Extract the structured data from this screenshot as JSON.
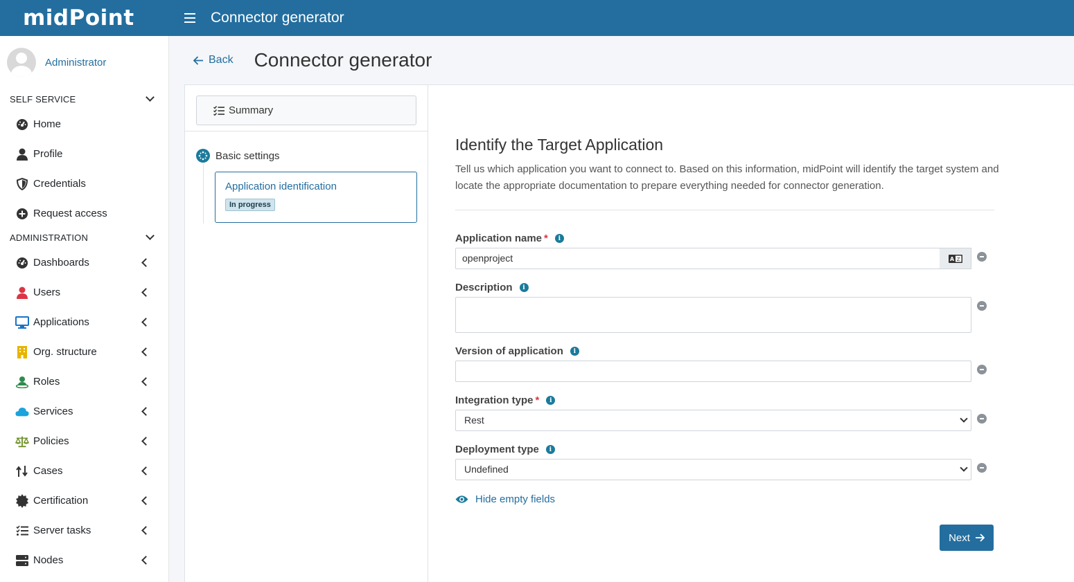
{
  "app": {
    "logo": "midPoint",
    "page_title": "Connector generator"
  },
  "user": {
    "name": "Administrator"
  },
  "sidebar": {
    "sections": [
      {
        "label": "SELF SERVICE"
      },
      {
        "label": "ADMINISTRATION"
      }
    ],
    "self_service": [
      {
        "label": "Home",
        "icon": "dashboard-gauge-icon"
      },
      {
        "label": "Profile",
        "icon": "user-icon"
      },
      {
        "label": "Credentials",
        "icon": "shield-icon"
      },
      {
        "label": "Request access",
        "icon": "plus-circle-icon"
      }
    ],
    "administration": [
      {
        "label": "Dashboards",
        "icon": "dashboard-gauge-icon"
      },
      {
        "label": "Users",
        "icon": "user-icon",
        "color": "#dc3545"
      },
      {
        "label": "Applications",
        "icon": "monitor-icon",
        "color": "#1a73c8"
      },
      {
        "label": "Org. structure",
        "icon": "building-icon",
        "color": "#e8b400"
      },
      {
        "label": "Roles",
        "icon": "role-icon",
        "color": "#2f8a4d"
      },
      {
        "label": "Services",
        "icon": "cloud-icon",
        "color": "#1aa3dc"
      },
      {
        "label": "Policies",
        "icon": "scale-icon",
        "color": "#6b8e23"
      },
      {
        "label": "Cases",
        "icon": "cases-icon"
      },
      {
        "label": "Certification",
        "icon": "certificate-icon"
      },
      {
        "label": "Server tasks",
        "icon": "tasks-list-icon"
      },
      {
        "label": "Nodes",
        "icon": "server-icon"
      }
    ]
  },
  "header": {
    "back_label": "Back",
    "title": "Connector generator"
  },
  "steps": {
    "summary_label": "Summary",
    "group_label": "Basic settings",
    "current_step": {
      "label": "Application identification",
      "status": "In progress"
    }
  },
  "form": {
    "title": "Identify the Target Application",
    "description": "Tell us which application you want to connect to. Based on this information, midPoint will identify the target system and locate the appropriate documentation to prepare everything needed for connector generation.",
    "fields": {
      "application_name": {
        "label": "Application name",
        "required": true,
        "value": "openproject"
      },
      "description": {
        "label": "Description",
        "required": false,
        "value": ""
      },
      "version": {
        "label": "Version of application",
        "required": false,
        "value": ""
      },
      "integration_type": {
        "label": "Integration type",
        "required": true,
        "value": "Rest"
      },
      "deployment_type": {
        "label": "Deployment type",
        "required": false,
        "value": "Undefined"
      }
    },
    "hide_empty_label": "Hide empty fields",
    "next_label": "Next"
  },
  "colors": {
    "primary": "#236e9f",
    "required": "#dc3545",
    "info": "#1b7a9c"
  }
}
